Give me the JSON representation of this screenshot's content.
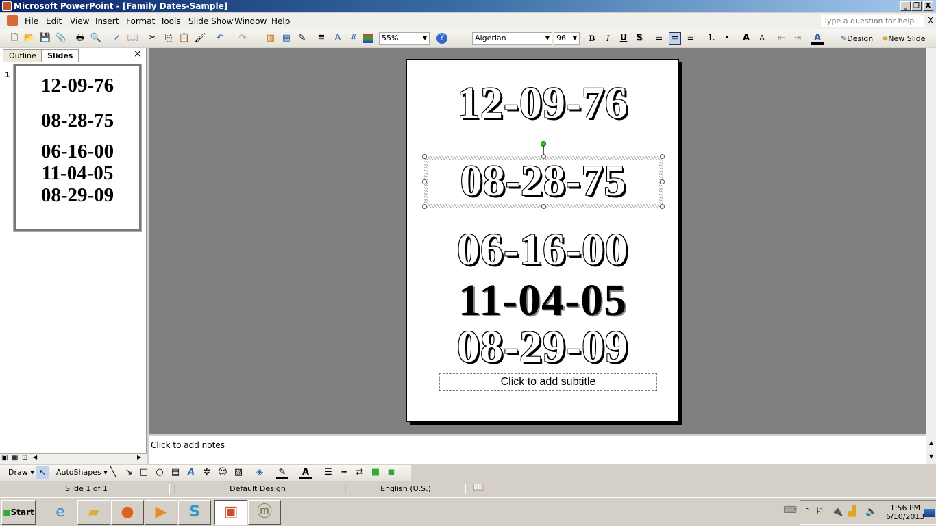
{
  "window": {
    "title": "Microsoft PowerPoint - [Family Dates-Sample]",
    "minimize": "_",
    "restore": "❐",
    "close": "X"
  },
  "menu": [
    "File",
    "Edit",
    "View",
    "Insert",
    "Format",
    "Tools",
    "Slide Show",
    "Window",
    "Help"
  ],
  "help": {
    "placeholder": "Type a question for help",
    "close": "X"
  },
  "toolbar": {
    "zoom": "55%",
    "font": "Algerian",
    "size": "96",
    "bold": "B",
    "italic": "I",
    "underline": "U",
    "shadow": "S",
    "design": "Design",
    "new_slide": "New Slide"
  },
  "pane": {
    "tabs": [
      "Outline",
      "Slides"
    ],
    "active_tab": "Slides",
    "close": "×",
    "slide_number": "1"
  },
  "slide": {
    "dates": [
      "12-09-76",
      "08-28-75",
      "06-16-00",
      "11-04-05",
      "08-29-09"
    ],
    "subtitle_placeholder": "Click to add subtitle"
  },
  "notes": {
    "placeholder": "Click to add notes"
  },
  "drawbar": {
    "draw": "Draw",
    "autoshapes": "AutoShapes"
  },
  "status": {
    "slide": "Slide 1 of 1",
    "design": "Default Design",
    "language": "English (U.S.)"
  },
  "taskbar": {
    "start": "Start",
    "time": "1:56 PM",
    "date": "6/10/2013"
  }
}
